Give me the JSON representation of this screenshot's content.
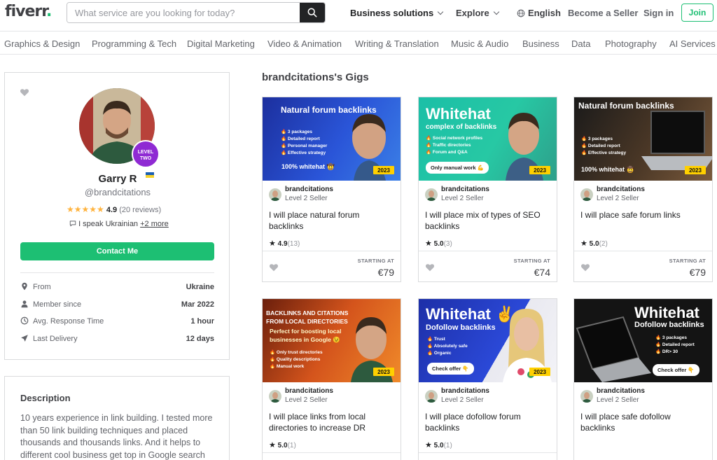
{
  "header": {
    "logo": "fiverr",
    "logo_dot": ".",
    "search_placeholder": "What service are you looking for today?",
    "nav": {
      "business_solutions": "Business solutions",
      "explore": "Explore",
      "language": "English",
      "become_seller": "Become a Seller",
      "sign_in": "Sign in",
      "join": "Join"
    }
  },
  "categories": [
    "Graphics & Design",
    "Programming & Tech",
    "Digital Marketing",
    "Video & Animation",
    "Writing & Translation",
    "Music & Audio",
    "Business",
    "Data",
    "Photography",
    "AI Services"
  ],
  "profile": {
    "level_badge_line1": "LEVEL",
    "level_badge_line2": "TWO",
    "name": "Garry R",
    "username": "@brandcitations",
    "stars": "★★★★★",
    "rating": "4.9",
    "reviews": "(20 reviews)",
    "languages_prefix": "I speak Ukrainian",
    "languages_more": "+2 more",
    "contact_label": "Contact Me",
    "stats": [
      {
        "label": "From",
        "value": "Ukraine"
      },
      {
        "label": "Member since",
        "value": "Mar 2022"
      },
      {
        "label": "Avg. Response Time",
        "value": "1 hour"
      },
      {
        "label": "Last Delivery",
        "value": "12 days"
      }
    ]
  },
  "description": {
    "title": "Description",
    "text": "10 years experience in link building. I tested more than 50 link building techniques and placed thousands and thousands links. And it helps to different cool business get top in Google search"
  },
  "gigs_section": {
    "title": "brandcitations's Gigs",
    "starting_at_label": "STARTING AT",
    "gigs": [
      {
        "seller": "brandcitations",
        "level": "Level 2 Seller",
        "title": "I will place natural forum backlinks",
        "rating": "4.9",
        "count": "(13)",
        "price": "€79",
        "thumb": {
          "headline": "Natural forum backlinks",
          "bullets": [
            "🔥 3 packages",
            "🔥 Detailed report",
            "🔥 Personal manager",
            "🔥 Effective strategy"
          ],
          "footer": "100% whitehat 🤠",
          "year": "2023"
        }
      },
      {
        "seller": "brandcitations",
        "level": "Level 2 Seller",
        "title": "I will place mix of types of SEO backlinks",
        "rating": "5.0",
        "count": "(3)",
        "price": "€74",
        "thumb": {
          "headline": "Whitehat",
          "subheadline": "complex of backlinks",
          "bullets": [
            "🔥 Social network profiles",
            "🔥 Traffic directories",
            "🔥 Forum and Q&A"
          ],
          "pill": "Only manual work 💪",
          "year": "2023"
        }
      },
      {
        "seller": "brandcitations",
        "level": "Level 2 Seller",
        "title": "I will place safe forum links",
        "rating": "5.0",
        "count": "(2)",
        "price": "€79",
        "thumb": {
          "headline": "Natural forum backlinks",
          "bullets": [
            "🔥 3 packages",
            "🔥 Detailed report",
            "🔥 Effective strategy"
          ],
          "footer": "100% whitehat 🤠",
          "year": "2023"
        }
      },
      {
        "seller": "brandcitations",
        "level": "Level 2 Seller",
        "title": "I will place links from local directories to increase DR",
        "rating": "5.0",
        "count": "(1)",
        "thumb": {
          "headline": "BACKLINKS AND CITATIONS FROM LOCAL DIRECTORIES",
          "subheadline": "Perfect for boosting local businesses in Google 😉",
          "bullets": [
            "🔥 Only trust directories",
            "🔥 Quality descriptions",
            "🔥 Manual work"
          ],
          "year": "2023"
        }
      },
      {
        "seller": "brandcitations",
        "level": "Level 2 Seller",
        "title": "I will place dofollow forum backlinks",
        "rating": "5.0",
        "count": "(1)",
        "thumb": {
          "headline": "Whitehat ✌",
          "subheadline": "Dofollow backlinks",
          "bullets": [
            "🔥 Trust",
            "🔥 Absolutely safe",
            "🔥 Organic"
          ],
          "pill": "Check offer 👇",
          "year": "2023"
        }
      },
      {
        "seller": "brandcitations",
        "level": "Level 2 Seller",
        "title": "I will place safe dofollow backlinks",
        "thumb": {
          "headline": "Whitehat",
          "subheadline": "Dofollow backlinks",
          "bullets": [
            "🔥 3 packages",
            "🔥 Detailed report",
            "🔥 DR> 30"
          ],
          "pill": "Check offer 👇"
        }
      }
    ]
  },
  "colors": {
    "brand_green": "#1dbf73",
    "level_badge": "#8f2ad3",
    "star": "#ffb33e",
    "year_tag": "#ffd000"
  },
  "icons": [
    "search-icon",
    "chevron-down-icon",
    "globe-icon",
    "heart-icon",
    "chat-icon",
    "location-pin-icon",
    "person-icon",
    "clock-icon",
    "send-icon",
    "star-icon"
  ]
}
